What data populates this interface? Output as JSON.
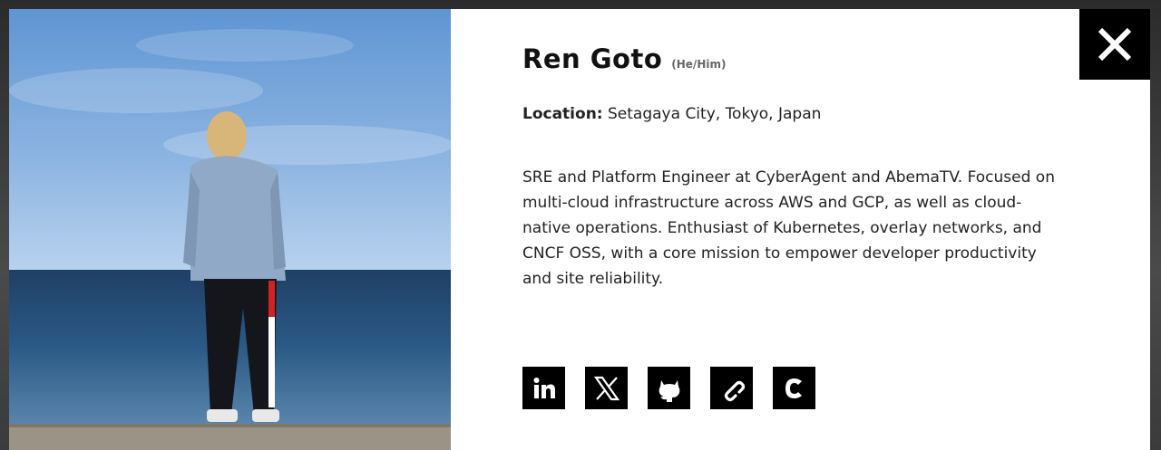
{
  "profile": {
    "name": "Ren Goto",
    "pronouns": "(He/Him)",
    "location_label": "Location:",
    "location_value": "Setagaya City, Tokyo, Japan",
    "bio": "SRE and Platform Engineer at CyberAgent and AbemaTV. Focused on multi-cloud infrastructure across AWS and GCP, as well as cloud-native operations. Enthusiast of Kubernetes, overlay networks, and CNCF OSS, with a core mission to empower developer productivity and site reliability."
  },
  "socials": [
    {
      "icon": "linkedin-icon"
    },
    {
      "icon": "x-twitter-icon"
    },
    {
      "icon": "github-icon"
    },
    {
      "icon": "link-icon"
    },
    {
      "icon": "c-logo-icon"
    }
  ],
  "controls": {
    "close_icon": "close-icon"
  },
  "colors": {
    "icon_bg": "#000000",
    "text": "#222222",
    "modal_bg": "#ffffff"
  }
}
